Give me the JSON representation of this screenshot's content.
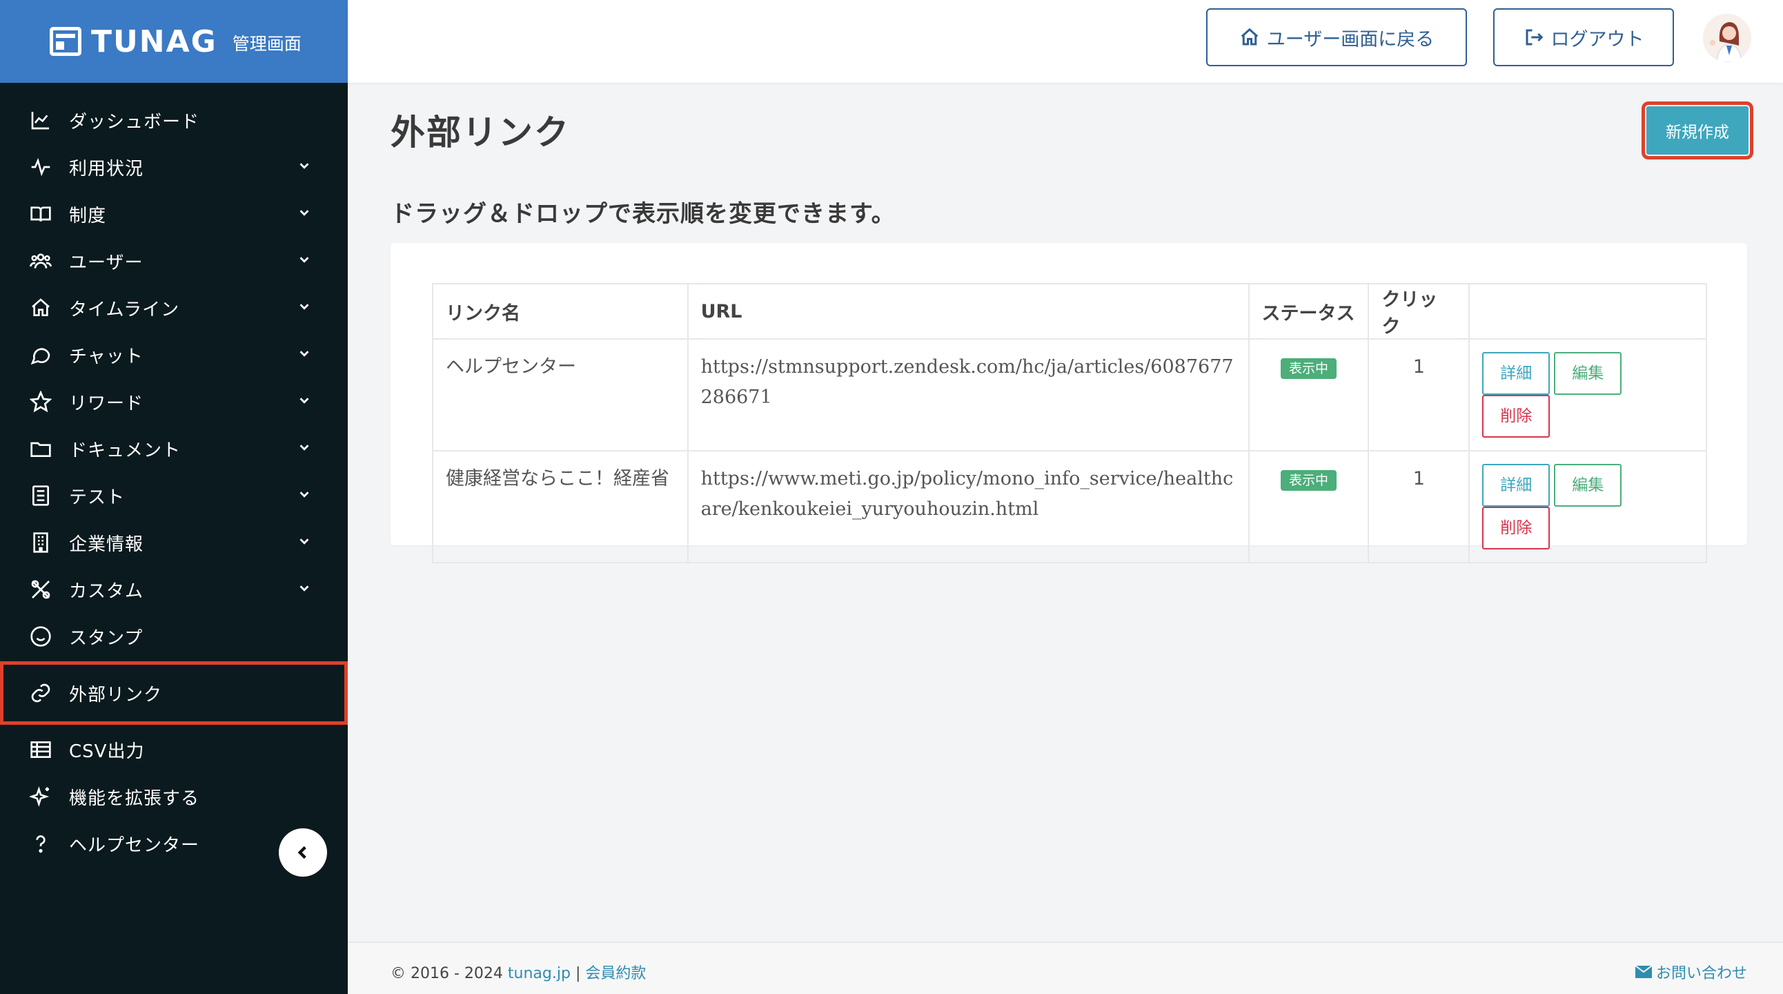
{
  "brand": {
    "name": "TUNAG",
    "sub": "管理画面"
  },
  "header": {
    "home_label": "ユーザー画面に戻る",
    "logout_label": "ログアウト"
  },
  "sidebar": {
    "items": [
      {
        "label": "ダッシュボード",
        "icon": "chart-line-icon",
        "chevron": false
      },
      {
        "label": "利用状況",
        "icon": "activity-icon",
        "chevron": true
      },
      {
        "label": "制度",
        "icon": "book-icon",
        "chevron": true
      },
      {
        "label": "ユーザー",
        "icon": "users-icon",
        "chevron": true
      },
      {
        "label": "タイムライン",
        "icon": "home-icon",
        "chevron": true
      },
      {
        "label": "チャット",
        "icon": "chat-bubble-icon",
        "chevron": true
      },
      {
        "label": "リワード",
        "icon": "star-icon",
        "chevron": true
      },
      {
        "label": "ドキュメント",
        "icon": "folder-icon",
        "chevron": true
      },
      {
        "label": "テスト",
        "icon": "checklist-icon",
        "chevron": true
      },
      {
        "label": "企業情報",
        "icon": "building-icon",
        "chevron": true
      },
      {
        "label": "カスタム",
        "icon": "tools-icon",
        "chevron": true
      },
      {
        "label": "スタンプ",
        "icon": "smile-icon",
        "chevron": false
      },
      {
        "label": "外部リンク",
        "icon": "link-icon",
        "chevron": false,
        "active": true
      },
      {
        "label": "CSV出力",
        "icon": "table-icon",
        "chevron": false
      },
      {
        "label": "機能を拡張する",
        "icon": "sparkle-icon",
        "chevron": false
      },
      {
        "label": "ヘルプセンター",
        "icon": "question-icon",
        "chevron": false
      }
    ]
  },
  "main": {
    "title": "外部リンク",
    "new_button": "新規作成",
    "subtitle": "ドラッグ＆ドロップで表示順を変更できます。",
    "table": {
      "headers": [
        "リンク名",
        "URL",
        "ステータス",
        "クリック",
        ""
      ],
      "rows": [
        {
          "name": "ヘルプセンター",
          "url": "https://stmnsupport.zendesk.com/hc/ja/articles/6087677286671",
          "status": "表示中",
          "clicks": "1",
          "detail": "詳細",
          "edit": "編集",
          "delete": "削除"
        },
        {
          "name": "健康経営ならここ！経産省",
          "url": "https://www.meti.go.jp/policy/mono_info_service/healthcare/kenkoukeiei_yuryouhouzin.html",
          "status": "表示中",
          "clicks": "1",
          "detail": "詳細",
          "edit": "編集",
          "delete": "削除"
        }
      ]
    }
  },
  "footer": {
    "copyright": "© 2016 - 2024",
    "site_link": "tunag.jp",
    "separator": "|",
    "terms_link": "会員約款",
    "contact": "お問い合わせ"
  },
  "colors": {
    "brand_blue": "#3b7ac4",
    "sidebar_bg": "#0b1a1e",
    "accent_teal": "#3ea7bd",
    "success_green": "#4cae7a",
    "danger_red": "#d9334d",
    "highlight_red": "#e0402a"
  }
}
